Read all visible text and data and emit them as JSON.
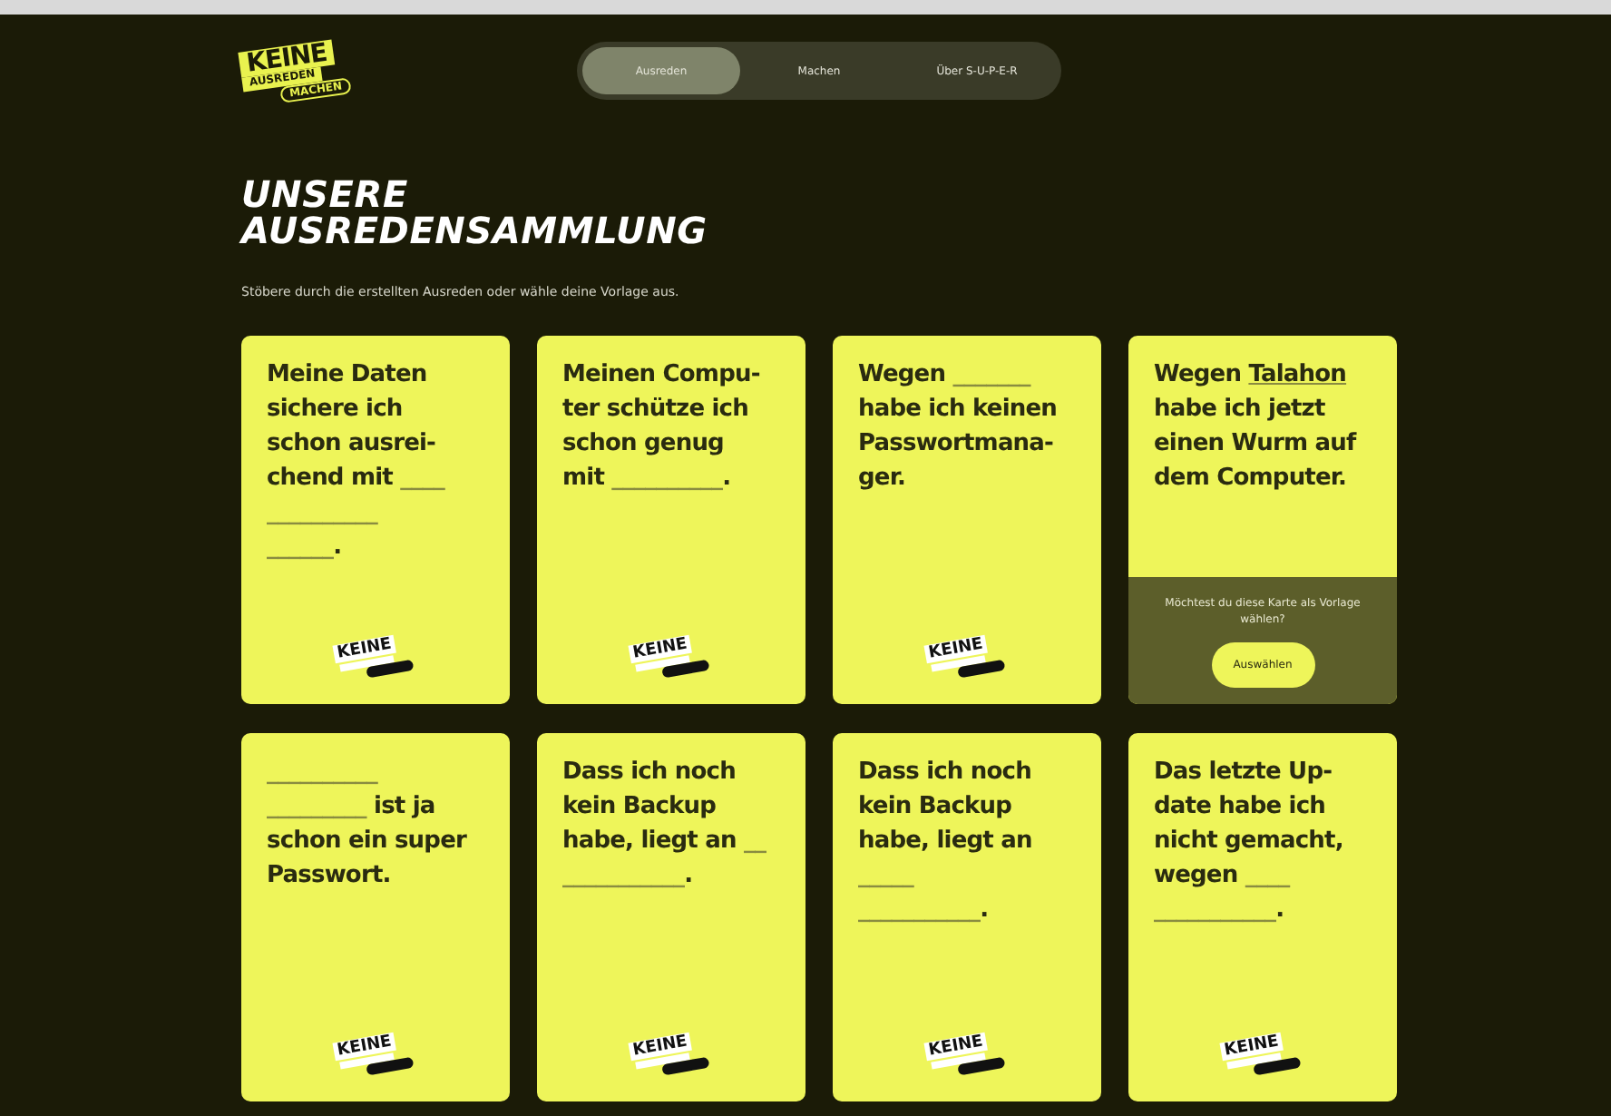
{
  "logo": {
    "lines": [
      "KEINE",
      "AUSREDEN",
      "MACHEN"
    ]
  },
  "nav": [
    {
      "label": "Ausreden",
      "selected": true
    },
    {
      "label": "Machen",
      "selected": false
    },
    {
      "label": "Über S-U-P-E-R",
      "selected": false
    }
  ],
  "heading": [
    "UNSERE",
    "AUSREDENSAMMLUNG"
  ],
  "intro": "Stöbere durch die erstellten Ausreden oder wähle deine Vorlage aus.",
  "cards": [
    {
      "lines": [
        [
          {
            "kind": "text",
            "text": "Meine Daten"
          }
        ],
        [
          {
            "kind": "text",
            "text": "sichere ich"
          }
        ],
        [
          {
            "kind": "text",
            "text": "schon ausrei-"
          }
        ],
        [
          {
            "kind": "text",
            "text": "chend mit "
          },
          {
            "kind": "blank",
            "text": "____"
          }
        ],
        [
          {
            "kind": "blank",
            "text": "__________"
          }
        ],
        [
          {
            "kind": "blank",
            "text": "______"
          },
          {
            "kind": "text",
            "text": "."
          }
        ]
      ],
      "logo_word": "KEINE"
    },
    {
      "lines": [
        [
          {
            "kind": "text",
            "text": "Meinen Compu-"
          }
        ],
        [
          {
            "kind": "text",
            "text": "ter schütze ich"
          }
        ],
        [
          {
            "kind": "text",
            "text": "schon genug"
          }
        ],
        [
          {
            "kind": "text",
            "text": "mit "
          },
          {
            "kind": "blank",
            "text": "__________"
          },
          {
            "kind": "text",
            "text": "."
          }
        ]
      ],
      "logo_word": "KEINE"
    },
    {
      "lines": [
        [
          {
            "kind": "text",
            "text": "Wegen "
          },
          {
            "kind": "blank",
            "text": "_______"
          }
        ],
        [
          {
            "kind": "text",
            "text": "habe ich keinen"
          }
        ],
        [
          {
            "kind": "text",
            "text": "Passwortmana-"
          }
        ],
        [
          {
            "kind": "text",
            "text": "ger."
          }
        ]
      ],
      "logo_word": "KEINE"
    },
    {
      "lines": [
        [
          {
            "kind": "text",
            "text": "Wegen "
          },
          {
            "kind": "filled",
            "text": "Talahon"
          }
        ],
        [
          {
            "kind": "text",
            "text": "habe ich jetzt"
          }
        ],
        [
          {
            "kind": "text",
            "text": "einen Wurm auf"
          }
        ],
        [
          {
            "kind": "text",
            "text": "dem Computer."
          }
        ]
      ],
      "overlay": {
        "text": "Möchtest du diese Karte als Vorlage wählen?",
        "button": "Auswählen"
      }
    },
    {
      "lines": [
        [
          {
            "kind": "blank",
            "text": "__________"
          }
        ],
        [
          {
            "kind": "blank",
            "text": "_________"
          },
          {
            "kind": "text",
            "text": " ist ja"
          }
        ],
        [
          {
            "kind": "text",
            "text": "schon ein super"
          }
        ],
        [
          {
            "kind": "text",
            "text": "Passwort."
          }
        ]
      ],
      "logo_word": "KEINE"
    },
    {
      "lines": [
        [
          {
            "kind": "text",
            "text": "Dass ich noch"
          }
        ],
        [
          {
            "kind": "text",
            "text": "kein Backup"
          }
        ],
        [
          {
            "kind": "text",
            "text": "habe, liegt an "
          },
          {
            "kind": "blank",
            "text": "__"
          }
        ],
        [
          {
            "kind": "blank",
            "text": "___________"
          },
          {
            "kind": "text",
            "text": "."
          }
        ]
      ],
      "logo_word": "KEINE"
    },
    {
      "lines": [
        [
          {
            "kind": "text",
            "text": "Dass ich noch"
          }
        ],
        [
          {
            "kind": "text",
            "text": "kein Backup"
          }
        ],
        [
          {
            "kind": "text",
            "text": "habe, liegt an"
          }
        ],
        [
          {
            "kind": "blank",
            "text": "_____"
          }
        ],
        [
          {
            "kind": "blank",
            "text": "___________"
          },
          {
            "kind": "text",
            "text": "."
          }
        ]
      ],
      "logo_word": "KEINE"
    },
    {
      "lines": [
        [
          {
            "kind": "text",
            "text": "Das letzte Up-"
          }
        ],
        [
          {
            "kind": "text",
            "text": "date habe ich"
          }
        ],
        [
          {
            "kind": "text",
            "text": "nicht gemacht,"
          }
        ],
        [
          {
            "kind": "text",
            "text": "wegen "
          },
          {
            "kind": "blank",
            "text": "____"
          }
        ],
        [
          {
            "kind": "blank",
            "text": "___________"
          },
          {
            "kind": "text",
            "text": "."
          }
        ]
      ],
      "logo_word": "KEINE"
    }
  ]
}
